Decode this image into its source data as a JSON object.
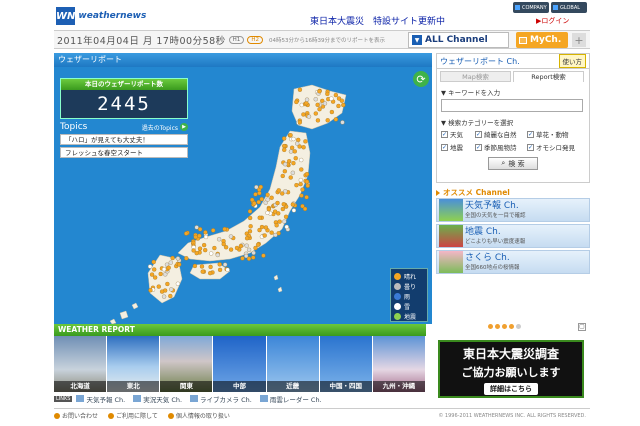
{
  "header": {
    "logo_mark": "WN",
    "logo_text": "weathernews",
    "news_link": "東日本大震災　特設サイト更新中",
    "company_label": "COMPANY",
    "global_label": "GLOBAL",
    "login_label": "ログイン"
  },
  "status": {
    "datetime": "2011年04月04日 月 17時00分58秒",
    "pill_1": "H1",
    "pill_2": "H2",
    "message": "04時53分から16時39分までのリポートを表示",
    "all_channel": "ALL Channel",
    "my_channel": "MyCh.",
    "plus": "+"
  },
  "map": {
    "title": "ウェザーリポート",
    "counter_label": "本日のウェザーリポート数",
    "counter_value": "2445",
    "topics_title": "Topics",
    "past_topics": "過去のTopics",
    "topics": [
      "「ハロ」が見えても大丈夫！",
      "フレッシュな春空スタート"
    ],
    "legend": [
      {
        "label": "晴れ",
        "color": "#f5a623"
      },
      {
        "label": "曇り",
        "color": "#bbbbbb"
      },
      {
        "label": "雨",
        "color": "#3a7bd5"
      },
      {
        "label": "雪",
        "color": "#ffffff"
      },
      {
        "label": "地震",
        "color": "#8fd14f"
      }
    ]
  },
  "weather_report": {
    "title": "WEATHER REPORT",
    "regions": [
      "北海道",
      "東北",
      "関東",
      "中部",
      "近畿",
      "中国・四国",
      "九州・沖縄"
    ],
    "links_tag": "LINKS",
    "links": [
      "天気予報 Ch.",
      "実況天気 Ch.",
      "ライブカメラ Ch.",
      "雨雲レーダー Ch."
    ]
  },
  "search_panel": {
    "title": "ウェザーリポート Ch.",
    "usage": "使い方",
    "tabs": [
      "Map検索",
      "Report検索"
    ],
    "keyword_label": "▼ キーワードを入力",
    "category_label": "▼ 検索カテゴリーを選択",
    "categories": [
      "天気",
      "綺麗な自然",
      "草花・動物",
      "地震",
      "季節風物詩",
      "オモシロ発見"
    ],
    "search_button": "検 索"
  },
  "recommend": {
    "title": "オススメ Channel",
    "items": [
      {
        "name": "天気予報 Ch.",
        "desc": "全国の天気を一目で確認"
      },
      {
        "name": "地震 Ch.",
        "desc": "どこよりも早い震度速報"
      },
      {
        "name": "さくら Ch.",
        "desc": "全国660地点の桜情報"
      }
    ]
  },
  "banner": {
    "line1": "東日本大震災調査",
    "line2": "ご協力お願いします",
    "line3": "詳細はこちら"
  },
  "footer": {
    "links": [
      "お問い合わせ",
      "ご利用に際して",
      "個人情報の取り扱い"
    ],
    "copyright": "© 1996-2011 WEATHERNEWS INC. ALL RIGHTS RESERVED."
  }
}
